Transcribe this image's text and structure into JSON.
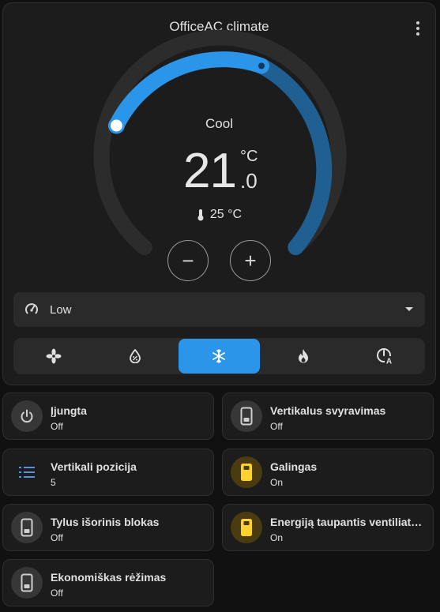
{
  "card": {
    "title": "OfficeAC climate",
    "mode_label": "Cool",
    "target_temp_integer": "21",
    "target_temp_decimal": ".0",
    "temp_unit": "°C",
    "current_temp": "25 °C",
    "minus_label": "−",
    "plus_label": "+",
    "fan_mode": "Low",
    "hvac_modes": [
      "fan_only",
      "dry",
      "cool",
      "heat",
      "heat_cool"
    ],
    "active_mode": "cool"
  },
  "colors": {
    "accent": "#2b95e9",
    "accent_dark": "#1f5f92",
    "track": "#2c2c2c",
    "yellow_icon": "#fdd22e"
  },
  "tiles": [
    {
      "name": "Įjungta",
      "state": "Off",
      "icon": "power-icon"
    },
    {
      "name": "Vertikalus svyravimas",
      "state": "Off",
      "icon": "switch-icon"
    },
    {
      "name": "Vertikali pozicija",
      "state": "5",
      "icon": "list-icon"
    },
    {
      "name": "Galingas",
      "state": "On",
      "icon": "switch-on-icon"
    },
    {
      "name": "Tylus išorinis blokas",
      "state": "Off",
      "icon": "switch-icon"
    },
    {
      "name": "Energiją taupantis ventiliatorius",
      "state": "On",
      "icon": "switch-on-icon"
    },
    {
      "name": "Ekonomiškas rėžimas",
      "state": "Off",
      "icon": "switch-icon"
    }
  ]
}
